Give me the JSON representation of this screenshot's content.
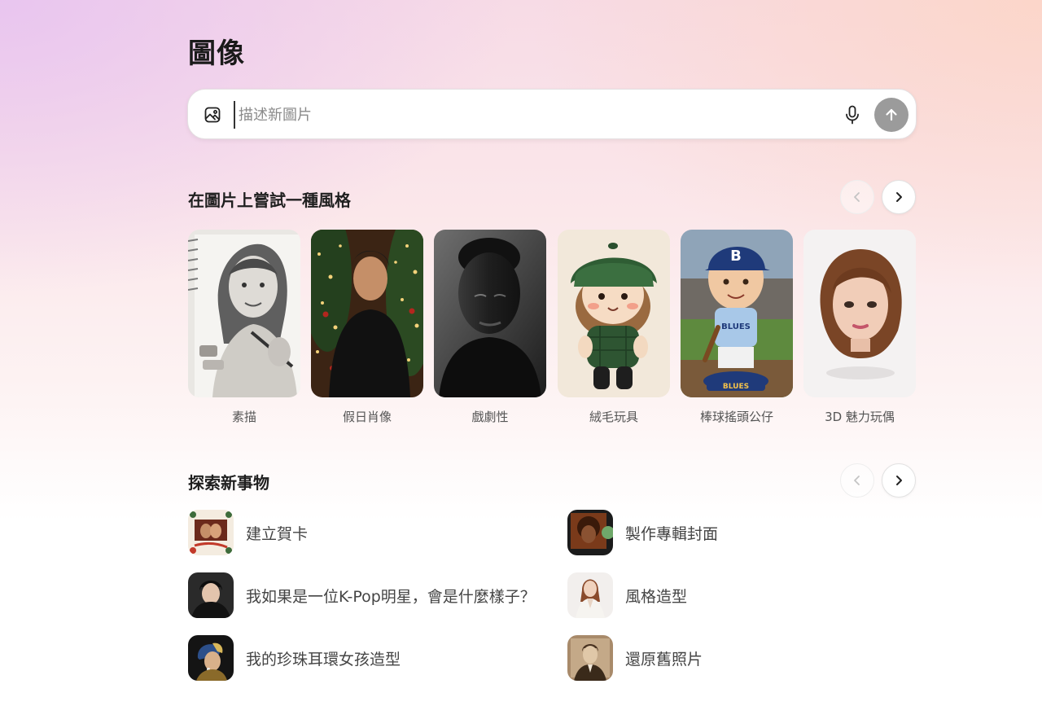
{
  "page": {
    "title": "圖像"
  },
  "search": {
    "placeholder": "描述新圖片",
    "value": ""
  },
  "styles": {
    "title": "在圖片上嘗試一種風格",
    "items": [
      {
        "label": "素描",
        "thumb": "pencil-sketch-portrait"
      },
      {
        "label": "假日肖像",
        "thumb": "holiday-portrait"
      },
      {
        "label": "戲劇性",
        "thumb": "dramatic-bw-portrait"
      },
      {
        "label": "絨毛玩具",
        "thumb": "plush-toy"
      },
      {
        "label": "棒球搖頭公仔",
        "thumb": "baseball-bobblehead"
      },
      {
        "label": "3D 魅力玩偶",
        "thumb": "3d-glam-doll"
      }
    ]
  },
  "explore": {
    "title": "探索新事物",
    "items": [
      {
        "label": "建立賀卡",
        "thumb": "holiday-card"
      },
      {
        "label": "製作專輯封面",
        "thumb": "album-cover"
      },
      {
        "label": "我如果是一位K-Pop明星，會是什麼樣子？",
        "thumb": "kpop-portrait"
      },
      {
        "label": "風格造型",
        "thumb": "fashion-style"
      },
      {
        "label": "我的珍珠耳環女孩造型",
        "thumb": "pearl-earring-portrait"
      },
      {
        "label": "還原舊照片",
        "thumb": "restore-old-photo"
      }
    ]
  },
  "icons": {
    "image-upload": "image-plus-icon",
    "mic": "microphone-icon",
    "send": "arrow-up-icon",
    "prev": "chevron-left-icon",
    "next": "chevron-right-icon"
  },
  "colors": {
    "send_button": "#9b9b9b",
    "text_primary": "#1f1f1f",
    "text_secondary": "#555555"
  }
}
